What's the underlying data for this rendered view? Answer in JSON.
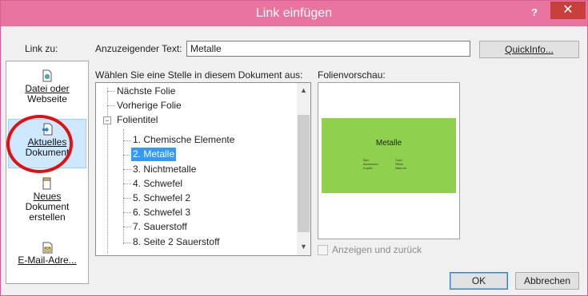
{
  "window": {
    "title": "Link einfügen",
    "help_label": "?",
    "close_label": "✕"
  },
  "link_to": {
    "label": "Link zu:",
    "items": [
      {
        "label_line1": "Datei oder",
        "label_line2": "Webseite",
        "icon": "globe-document-icon"
      },
      {
        "label_line1": "Aktuelles",
        "label_line2": "Dokument",
        "icon": "current-document-icon",
        "selected": true
      },
      {
        "label_line1": "Neues",
        "label_line2": "Dokument",
        "label_line3": "erstellen",
        "icon": "new-document-icon"
      },
      {
        "label_line1": "E-Mail-Adre...",
        "icon": "email-icon"
      }
    ]
  },
  "display_text": {
    "label": "Anzuzeigender Text:",
    "value": "Metalle"
  },
  "quickinfo_label": "QuickInfo...",
  "tree": {
    "label": "Wählen Sie eine Stelle in diesem Dokument aus:",
    "items": [
      "Nächste Folie",
      "Vorherige Folie",
      "Folientitel",
      "1. Chemische Elemente",
      "2. Metalle",
      "3. Nichtmetalle",
      "4. Schwefel",
      "5. Schwefel  2",
      "6. Schwefel  3",
      "7. Sauerstoff",
      "8. Seite 2 Sauerstoff"
    ],
    "expander_symbol": "−",
    "selected_index": 4
  },
  "preview": {
    "label": "Folienvorschau:",
    "slide_title": "Metalle",
    "slide_color": "#8fd14f",
    "bullets_left": [
      "Blei",
      "Aluminium",
      "Kupfer"
    ],
    "bullets_right": [
      "Gold",
      "Silber",
      "Natrium"
    ]
  },
  "show_and_return": {
    "label": "Anzeigen und zurück",
    "checked": false,
    "enabled": false
  },
  "buttons": {
    "ok": "OK",
    "cancel": "Abbrechen"
  },
  "colors": {
    "titlebar": "#e8749f",
    "close": "#c7403c",
    "selection": "#3399ff",
    "highlight_circle": "#e01010"
  }
}
